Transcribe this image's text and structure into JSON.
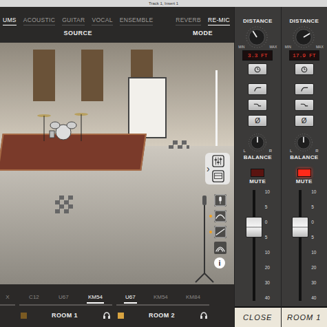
{
  "window": {
    "title": "Track 1, Insert 1"
  },
  "source": {
    "label": "SOURCE",
    "tabs": [
      {
        "label": "UMS",
        "selected": true
      },
      {
        "label": "ACOUSTIC",
        "selected": false
      },
      {
        "label": "GUITAR",
        "selected": false
      },
      {
        "label": "VOCAL",
        "selected": false
      },
      {
        "label": "ENSEMBLE",
        "selected": false
      }
    ]
  },
  "mode": {
    "label": "MODE",
    "tabs": [
      {
        "label": "REVERB",
        "selected": false
      },
      {
        "label": "RE-MIC",
        "selected": true
      }
    ]
  },
  "room_toolbar": {
    "expand": "›",
    "info": "i",
    "tools": [
      {
        "kind": "mic",
        "active": false
      },
      {
        "kind": "curve",
        "active": true
      },
      {
        "kind": "slope",
        "active": true
      },
      {
        "kind": "arcs",
        "active": false
      }
    ]
  },
  "mic_groups": [
    {
      "name": "",
      "color": "",
      "mics": [
        {
          "label": "X",
          "selected": false
        }
      ]
    },
    {
      "name": "ROOM 1",
      "color": "#7a5a22",
      "mics": [
        {
          "label": "C12",
          "selected": false
        },
        {
          "label": "U67",
          "selected": false
        },
        {
          "label": "KM54",
          "selected": true
        }
      ]
    },
    {
      "name": "ROOM 2",
      "color": "#d9a441",
      "mics": [
        {
          "label": "U67",
          "selected": true
        },
        {
          "label": "KM54",
          "selected": false
        },
        {
          "label": "KM84",
          "selected": false
        }
      ]
    }
  ],
  "fader_scale": [
    "10",
    "5",
    "0",
    "5",
    "10",
    "20",
    "30",
    "40"
  ],
  "channels": [
    {
      "distance_label": "DISTANCE",
      "min_label": "MIN",
      "max_label": "MAX",
      "distance": "3.3 FT",
      "distance_level": 0.38,
      "phase": "Ø",
      "balance_label": "BALANCE",
      "balance_l": "L",
      "balance_r": "R",
      "balance_level": 0.5,
      "mute_label": "MUTE",
      "muted": false,
      "fader_level": 0.7,
      "name": "CLOSE"
    },
    {
      "distance_label": "DISTANCE",
      "min_label": "MIN",
      "max_label": "MAX",
      "distance": "17.9 FT",
      "distance_level": 0.72,
      "phase": "Ø",
      "balance_label": "BALANCE",
      "balance_l": "L",
      "balance_r": "R",
      "balance_level": 0.5,
      "mute_label": "MUTE",
      "muted": true,
      "fader_level": 0.7,
      "name": "ROOM 1"
    }
  ]
}
